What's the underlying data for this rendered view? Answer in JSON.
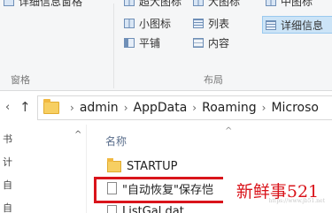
{
  "ribbon": {
    "row1": [
      "详细信息窗格",
      "超大图标",
      "大图标",
      "中图标"
    ],
    "row2": [
      "小图标",
      "列表",
      "详细信息"
    ],
    "row3": [
      "平铺",
      "内容"
    ],
    "caption_left": "窗格",
    "caption_layout": "布局"
  },
  "address": {
    "crumbs": [
      "admin",
      "AppData",
      "Roaming",
      "Microso"
    ]
  },
  "navpane": {
    "fragments": [
      "书",
      "计",
      "自",
      "自"
    ]
  },
  "filelist": {
    "column_header": "名称",
    "rows": [
      "STARTUP",
      "\"自动恢复\"保存恺",
      "ListGal.dat"
    ]
  },
  "watermark": {
    "text": "新鲜事521",
    "url": "https://www.jb51.net"
  }
}
